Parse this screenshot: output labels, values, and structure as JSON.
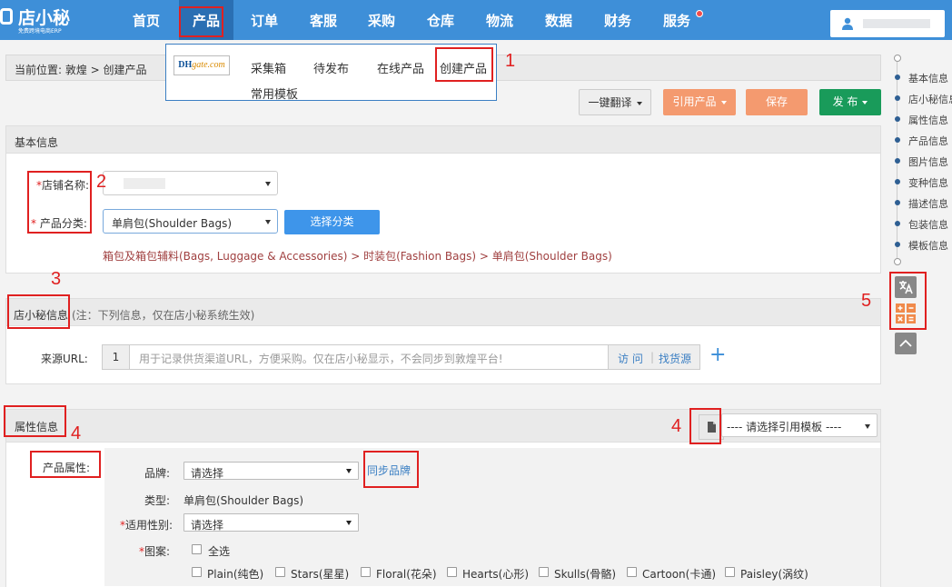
{
  "app": {
    "logo_title": "店小秘",
    "logo_subtitle": "免费跨境电商ERP"
  },
  "nav": {
    "items": [
      "首页",
      "产品",
      "订单",
      "客服",
      "采购",
      "仓库",
      "物流",
      "数据",
      "财务",
      "服务"
    ],
    "active": "产品"
  },
  "breadcrumb": {
    "text": "当前位置:  敦煌 > 创建产品"
  },
  "dropdown": {
    "logo_left": "DH",
    "logo_right": "gate.com",
    "items": [
      "采集箱",
      "待发布",
      "在线产品",
      "创建产品",
      "常用模板"
    ]
  },
  "actions": {
    "translate": "一键翻译",
    "quote": "引用产品",
    "save": "保存",
    "publish": "发  布"
  },
  "basic_info": {
    "title": "基本信息",
    "shop_label": "店铺名称:",
    "category_label": " 产品分类:",
    "category_value": "单肩包(Shoulder Bags)",
    "choose_category": "选择分类",
    "category_path": "箱包及箱包辅料(Bags, Luggage & Accessories) > 时装包(Fashion Bags) > 单肩包(Shoulder Bags)"
  },
  "dxm_info": {
    "title": "店小秘信息",
    "note": "(注：下列信息，仅在店小秘系统生效)",
    "url_label": "来源URL:",
    "url_index": "1",
    "url_placeholder": "用于记录供货渠道URL，方便采购。仅在店小秘显示，不会同步到敦煌平台!",
    "visit": "访 问",
    "find_source": "找货源"
  },
  "attributes": {
    "title": "属性信息",
    "template_select": "---- 请选择引用模板 ----",
    "product_attr_label": "产品属性:",
    "brand_label": "品牌:",
    "brand_value": "请选择",
    "sync_brand": "同步品牌",
    "type_label": "类型:",
    "type_value": "单肩包(Shoulder Bags)",
    "gender_label": "适用性别:",
    "gender_value": "请选择",
    "pattern_label": "图案:",
    "select_all": "全选",
    "patterns": [
      "Plain(纯色)",
      "Stars(星星)",
      "Floral(花朵)",
      "Hearts(心形)",
      "Skulls(骨骼)",
      "Cartoon(卡通)",
      "Paisley(涡纹)"
    ]
  },
  "right_nav": {
    "items": [
      "基本信息",
      "店小秘信息",
      "属性信息",
      "产品信息",
      "图片信息",
      "变种信息",
      "描述信息",
      "包装信息",
      "模板信息"
    ]
  },
  "annotations": [
    "1",
    "2",
    "3",
    "4",
    "4",
    "5"
  ],
  "colors": {
    "header": "#3e8fd8",
    "header_active": "#2a6fb3",
    "annotation": "#e02020",
    "orange_button": "#f49a6f",
    "green_button": "#199b5a",
    "blue_button": "#3e95ea"
  }
}
